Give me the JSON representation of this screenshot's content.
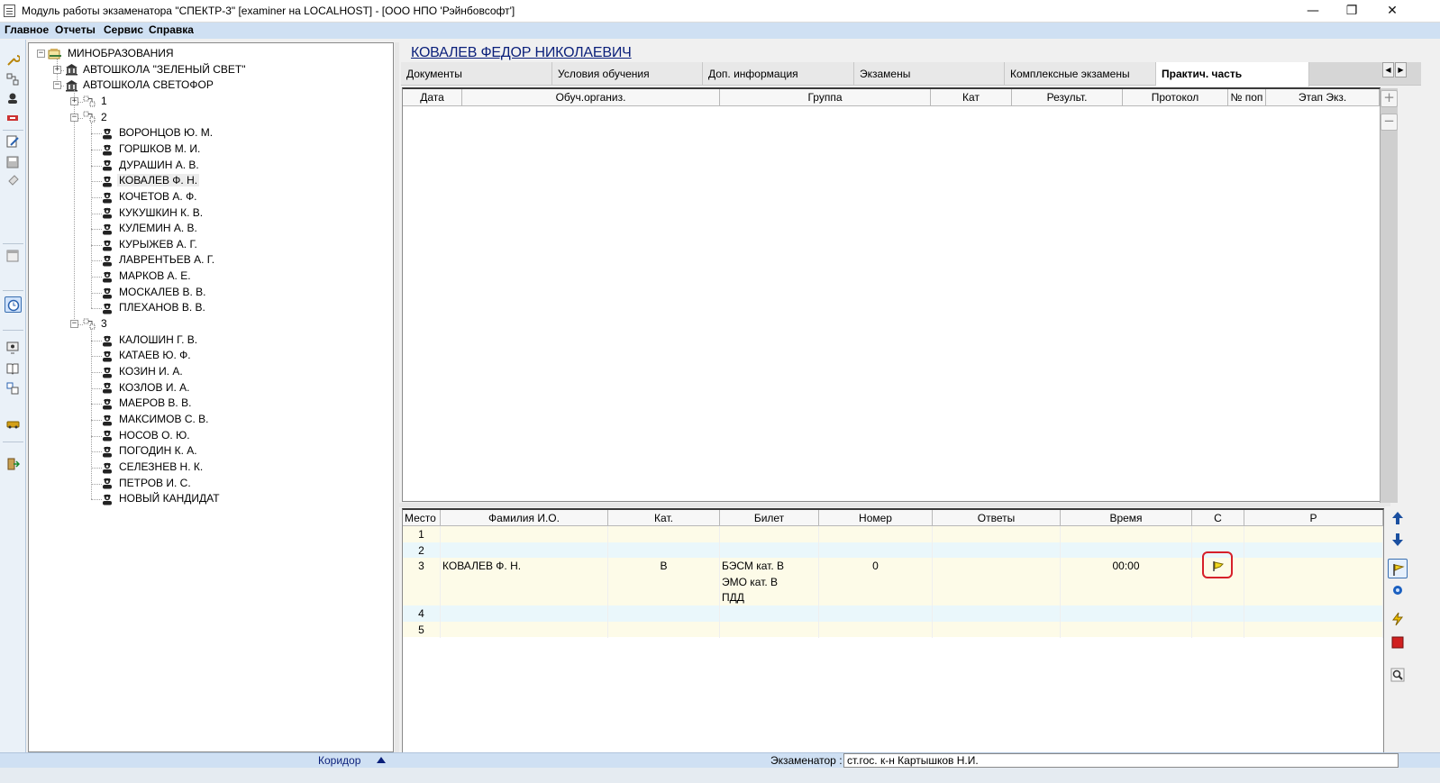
{
  "window": {
    "title": "Модуль работы экзаменатора \"СПЕКТР-3\" [examiner на LOCALHOST] - [ООО НПО 'Рэйнбовсофт']",
    "minimize": "—",
    "restore": "❐",
    "close": "✕"
  },
  "menu": [
    "Главное",
    "Отчеты",
    "Сервис",
    "Справка"
  ],
  "tree": {
    "root": "МИНОБРАЗОВАНИЯ",
    "school1": "АВТОШКОЛА \"ЗЕЛЕНЫЙ СВЕТ\"",
    "school2": "АВТОШКОЛА СВЕТОФОР",
    "group1": "1",
    "group2": "2",
    "group2_people": [
      "ВОРОНЦОВ Ю. М.",
      "ГОРШКОВ М. И.",
      "ДУРАШИН А. В.",
      "КОВАЛЕВ Ф. Н.",
      "КОЧЕТОВ А. Ф.",
      "КУКУШКИН К. В.",
      "КУЛЕМИН А. В.",
      "КУРЫЖЕВ А. Г.",
      "ЛАВРЕНТЬЕВ А. Г.",
      "МАРКОВ А. Е.",
      "МОСКАЛЕВ В. В.",
      "ПЛЕХАНОВ В. В."
    ],
    "group3": "3",
    "group3_people": [
      "КАЛОШИН Г. В.",
      "КАТАЕВ Ю. Ф.",
      "КОЗИН И. А.",
      "КОЗЛОВ И. А.",
      "МАЕРОВ В. В.",
      "МАКСИМОВ С. В.",
      "НОСОВ О. Ю.",
      "ПОГОДИН К. А.",
      "СЕЛЕЗНЕВ Н. К.",
      "ПЕТРОВ И. С.",
      "НОВЫЙ КАНДИДАТ"
    ],
    "selected": "КОВАЛЕВ Ф. Н."
  },
  "person_title": "КОВАЛЕВ ФЕДОР НИКОЛАЕВИЧ",
  "tabs": [
    "Документы",
    "Условия обучения",
    "Доп. информация",
    "Экзамены",
    "Комплексные экзамены",
    "Практич. часть"
  ],
  "tab_arrows": {
    "left": "◀",
    "right": "▶"
  },
  "upper_grid": {
    "columns": [
      "Дата",
      "Обуч.организ.",
      "Группа",
      "Кат",
      "Результ.",
      "Протокол",
      "№ поп",
      "Этап Экз."
    ],
    "add_button": "+",
    "remove_button": "−"
  },
  "lower_grid": {
    "columns": [
      "Место",
      "Фамилия И.О.",
      "Кат.",
      "Билет",
      "Номер",
      "Ответы",
      "Время",
      "С",
      "Р"
    ],
    "rows": [
      {
        "place": "1",
        "name": "",
        "cat": "",
        "ticket": "",
        "number": "",
        "answers": "",
        "time": ""
      },
      {
        "place": "2",
        "name": "",
        "cat": "",
        "ticket": "",
        "number": "",
        "answers": "",
        "time": ""
      },
      {
        "place": "3",
        "name": "КОВАЛЕВ Ф. Н.",
        "cat": "В",
        "ticket": "БЭСМ кат. В",
        "number": "0",
        "answers": "",
        "time": "00:00"
      },
      {
        "place": "",
        "name": "",
        "cat": "",
        "ticket": "ЭМО кат. В",
        "number": "",
        "answers": "",
        "time": ""
      },
      {
        "place": "",
        "name": "",
        "cat": "",
        "ticket": "ПДД",
        "number": "",
        "answers": "",
        "time": ""
      },
      {
        "place": "4",
        "name": "",
        "cat": "",
        "ticket": "",
        "number": "",
        "answers": "",
        "time": ""
      },
      {
        "place": "5",
        "name": "",
        "cat": "",
        "ticket": "",
        "number": "",
        "answers": "",
        "time": ""
      }
    ]
  },
  "status": {
    "left": "Коридор",
    "examiner_label": "Экзаменатор :",
    "examiner_value": "ст.гос. к-н Картышков Н.И."
  },
  "colors": {
    "accent": "#0a1f7a",
    "menubar": "#cfe0f3",
    "row_yellow": "#fdfbe8",
    "row_blue": "#eaf7fb",
    "highlight": "#d6202a"
  }
}
